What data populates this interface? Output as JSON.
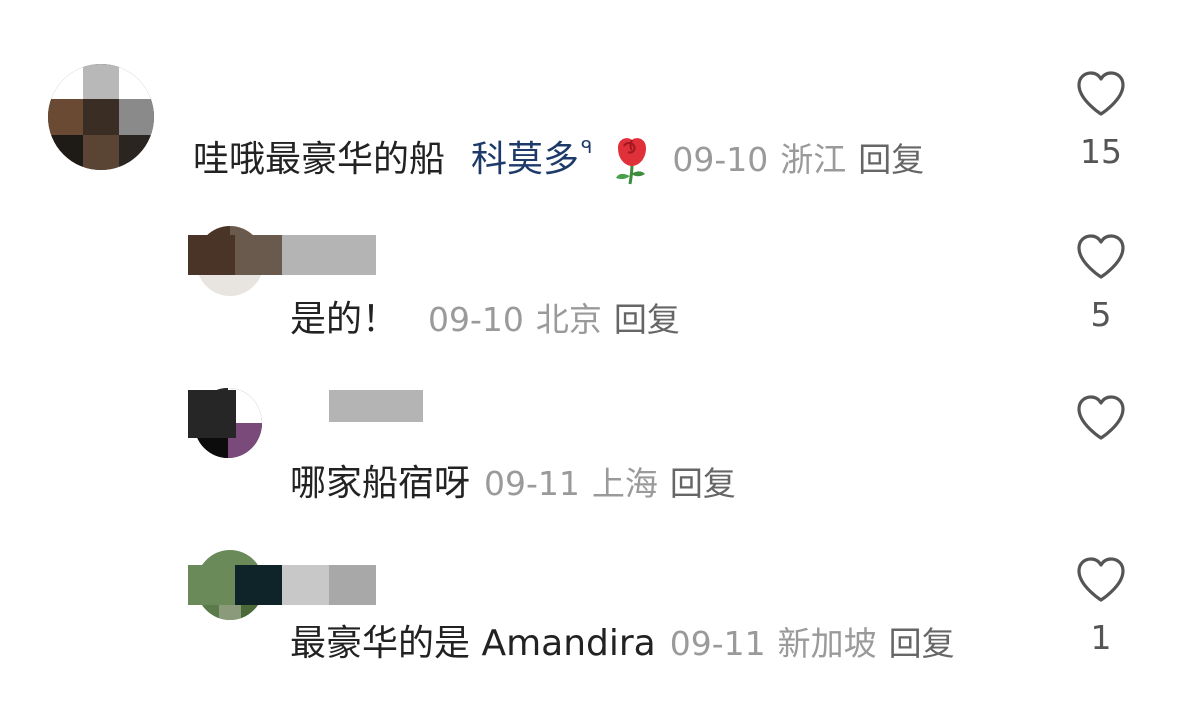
{
  "comments": [
    {
      "text": "哇哦最豪华的船",
      "mention": "科莫多",
      "search_mark": "ᑫ",
      "emoji": "rose",
      "date": "09-10",
      "location": "浙江",
      "reply_label": "回复",
      "likes": "15"
    },
    {
      "text": "是的！",
      "date": "09-10",
      "location": "北京",
      "reply_label": "回复",
      "likes": "5"
    },
    {
      "text": "哪家船宿呀",
      "date": "09-11",
      "location": "上海",
      "reply_label": "回复",
      "likes": ""
    },
    {
      "text": "最豪华的是 Amandira",
      "date": "09-11",
      "location": "新加坡",
      "reply_label": "回复",
      "likes": "1"
    }
  ],
  "icons": {
    "like": "heart-outline-icon",
    "emoji": "rose-emoji-icon"
  },
  "colors": {
    "text": "#222222",
    "mention": "#1e3a6a",
    "meta": "#9a9a9a",
    "reply": "#666666",
    "heart_stroke": "#555555"
  }
}
